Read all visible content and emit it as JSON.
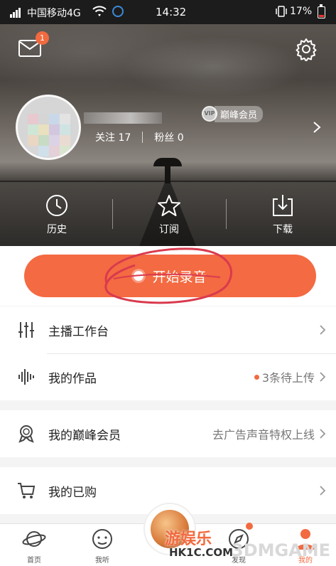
{
  "status_bar": {
    "carrier": "中国移动4G",
    "time": "14:32",
    "battery": "17%"
  },
  "header": {
    "mail_badge": "1"
  },
  "profile": {
    "vip_medal": "VIP",
    "vip_label": "巅峰会员",
    "following": "关注 17",
    "fans": "粉丝 0"
  },
  "quick_actions": [
    {
      "label": "历史",
      "icon": "clock-icon"
    },
    {
      "label": "订阅",
      "icon": "star-icon"
    },
    {
      "label": "下载",
      "icon": "download-icon"
    }
  ],
  "record_button": {
    "label": "开始录音"
  },
  "menu_groups": [
    [
      {
        "label": "主播工作台",
        "icon": "sliders-icon",
        "value": ""
      },
      {
        "label": "我的作品",
        "icon": "waveform-icon",
        "value": "3条待上传"
      }
    ],
    [
      {
        "label": "我的巅峰会员",
        "icon": "vip-badge-icon",
        "value": "去广告声音特权上线"
      }
    ],
    [
      {
        "label": "我的已购",
        "icon": "cart-icon",
        "value": ""
      }
    ]
  ],
  "bottom_nav": [
    {
      "label": "首页",
      "icon": "planet-icon"
    },
    {
      "label": "我听",
      "icon": "face-icon"
    },
    {
      "label": "发现",
      "icon": "compass-icon"
    },
    {
      "label": "我的",
      "icon": "person-icon"
    }
  ],
  "watermarks": {
    "site_cn": "游娱乐",
    "site_url": "HK1C.COM",
    "site_brand": "3DMGAME"
  },
  "colors": {
    "accent": "#f46a42",
    "badge": "#f26a3f"
  }
}
